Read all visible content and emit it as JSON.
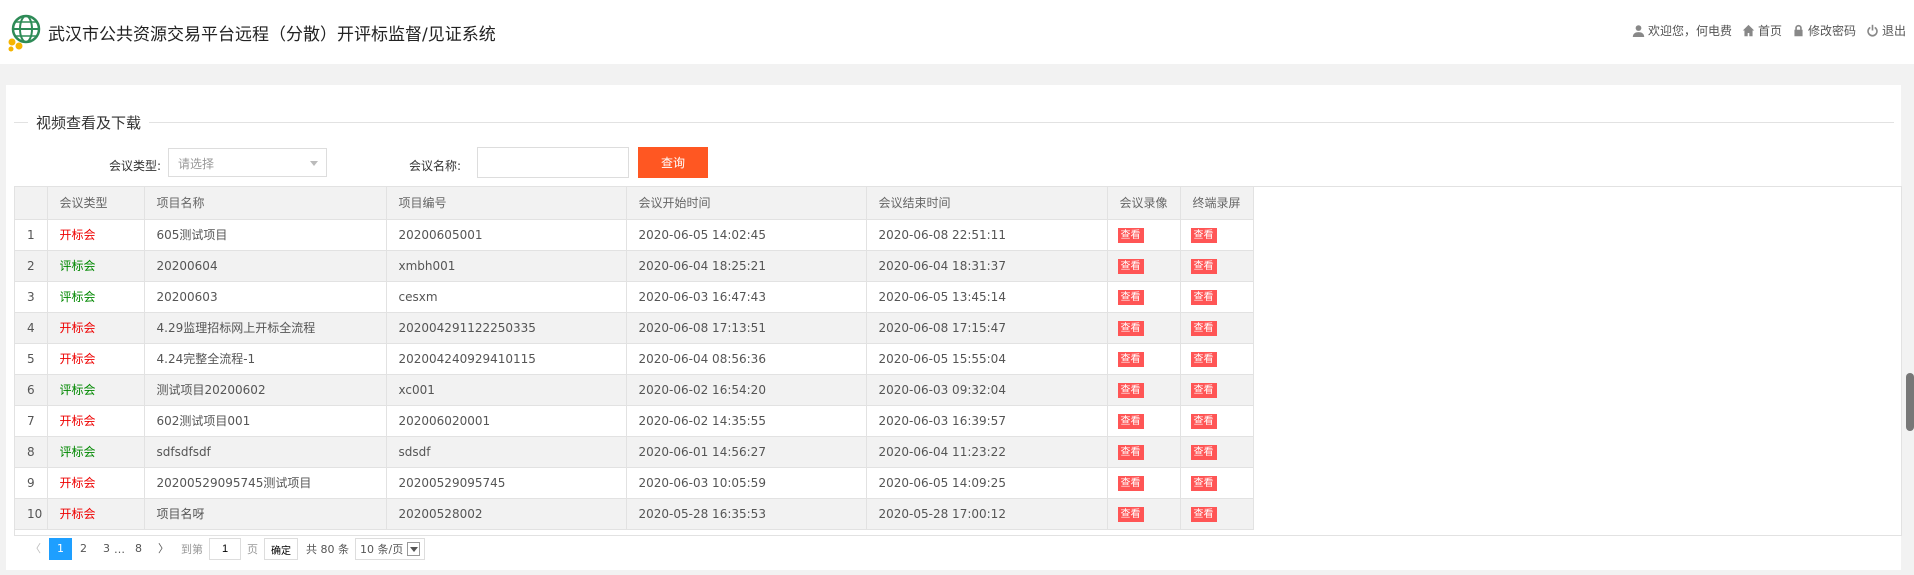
{
  "header": {
    "title": "武汉市公共资源交易平台远程（分散）开评标监督/见证系统",
    "welcome": "欢迎您，何电费",
    "home": "首页",
    "change_password": "修改密码",
    "logout": "退出"
  },
  "section": {
    "title": "视频查看及下载"
  },
  "filters": {
    "type_label": "会议类型:",
    "type_placeholder": "请选择",
    "name_label": "会议名称:",
    "query_label": "查询"
  },
  "table": {
    "columns": [
      "",
      "会议类型",
      "项目名称",
      "项目编号",
      "会议开始时间",
      "会议结束时间",
      "会议录像",
      "终端录屏"
    ],
    "view_label": "查看",
    "rows": [
      {
        "idx": "1",
        "type": "开标会",
        "kind": "kb",
        "name": "605测试项目",
        "code": "20200605001",
        "start": "2020-06-05 14:02:45",
        "end": "2020-06-08 22:51:11"
      },
      {
        "idx": "2",
        "type": "评标会",
        "kind": "pb",
        "name": "20200604",
        "code": "xmbh001",
        "start": "2020-06-04 18:25:21",
        "end": "2020-06-04 18:31:37"
      },
      {
        "idx": "3",
        "type": "评标会",
        "kind": "pb",
        "name": "20200603",
        "code": "cesxm",
        "start": "2020-06-03 16:47:43",
        "end": "2020-06-05 13:45:14"
      },
      {
        "idx": "4",
        "type": "开标会",
        "kind": "kb",
        "name": "4.29监理招标网上开标全流程",
        "code": "202004291122250335",
        "start": "2020-06-08 17:13:51",
        "end": "2020-06-08 17:15:47"
      },
      {
        "idx": "5",
        "type": "开标会",
        "kind": "kb",
        "name": "4.24完整全流程-1",
        "code": "202004240929410115",
        "start": "2020-06-04 08:56:36",
        "end": "2020-06-05 15:55:04"
      },
      {
        "idx": "6",
        "type": "评标会",
        "kind": "pb",
        "name": "测试项目20200602",
        "code": "xc001",
        "start": "2020-06-02 16:54:20",
        "end": "2020-06-03 09:32:04"
      },
      {
        "idx": "7",
        "type": "开标会",
        "kind": "kb",
        "name": "602测试项目001",
        "code": "202006020001",
        "start": "2020-06-02 14:35:55",
        "end": "2020-06-03 16:39:57"
      },
      {
        "idx": "8",
        "type": "评标会",
        "kind": "pb",
        "name": "sdfsdfsdf",
        "code": "sdsdf",
        "start": "2020-06-01 14:56:27",
        "end": "2020-06-04 11:23:22"
      },
      {
        "idx": "9",
        "type": "开标会",
        "kind": "kb",
        "name": "20200529095745测试项目",
        "code": "20200529095745",
        "start": "2020-06-03 10:05:59",
        "end": "2020-06-05 14:09:25"
      },
      {
        "idx": "10",
        "type": "开标会",
        "kind": "kb",
        "name": "项目名呀",
        "code": "20200528002",
        "start": "2020-05-28 16:35:53",
        "end": "2020-05-28 17:00:12"
      }
    ]
  },
  "pager": {
    "prev": "〈",
    "pages": [
      "1",
      "2",
      "3"
    ],
    "ellipsis": "…",
    "last": "8",
    "next": "〉",
    "goto_label": "到第",
    "goto_value": "1",
    "page_unit": "页",
    "ok": "确定",
    "total": "共 80 条",
    "page_size": "10 条/页"
  }
}
